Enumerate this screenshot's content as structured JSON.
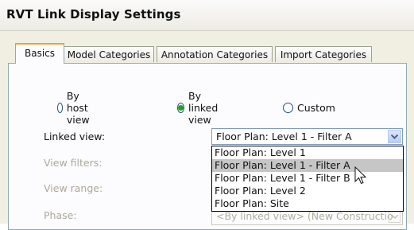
{
  "window": {
    "title": "RVT Link Display Settings"
  },
  "tabs": [
    {
      "label": "Basics",
      "active": true
    },
    {
      "label": "Model Categories",
      "active": false
    },
    {
      "label": "Annotation Categories",
      "active": false
    },
    {
      "label": "Import Categories",
      "active": false
    }
  ],
  "display_mode": {
    "options": [
      {
        "label": "By host view",
        "selected": false
      },
      {
        "label": "By linked view",
        "selected": true
      },
      {
        "label": "Custom",
        "selected": false
      }
    ]
  },
  "fields": {
    "linked_view_label": "Linked view:",
    "linked_view_value": "Floor Plan: Level 1 - Filter A",
    "view_filters_label": "View filters:",
    "view_range_label": "View range:",
    "phase_label": "Phase:",
    "phase_value": "<By linked view> (New Constructio"
  },
  "linked_view_dropdown": {
    "options": [
      {
        "label": "Floor Plan: Level 1",
        "highlighted": false
      },
      {
        "label": "Floor Plan: Level 1 - Filter A",
        "highlighted": true
      },
      {
        "label": "Floor Plan: Level 1 - Filter B",
        "highlighted": false
      },
      {
        "label": "Floor Plan: Level 2",
        "highlighted": false
      },
      {
        "label": "Floor Plan: Site",
        "highlighted": false
      }
    ]
  },
  "icons": {
    "dropdown_arrow": "chevron-down-icon",
    "cursor": "mouse-pointer-icon"
  },
  "colors": {
    "active_tab_accent": "#e7a53b",
    "radio_selected": "#21a121",
    "dropdown_highlight": "#c6c6c6",
    "disabled_text": "#aca899"
  }
}
